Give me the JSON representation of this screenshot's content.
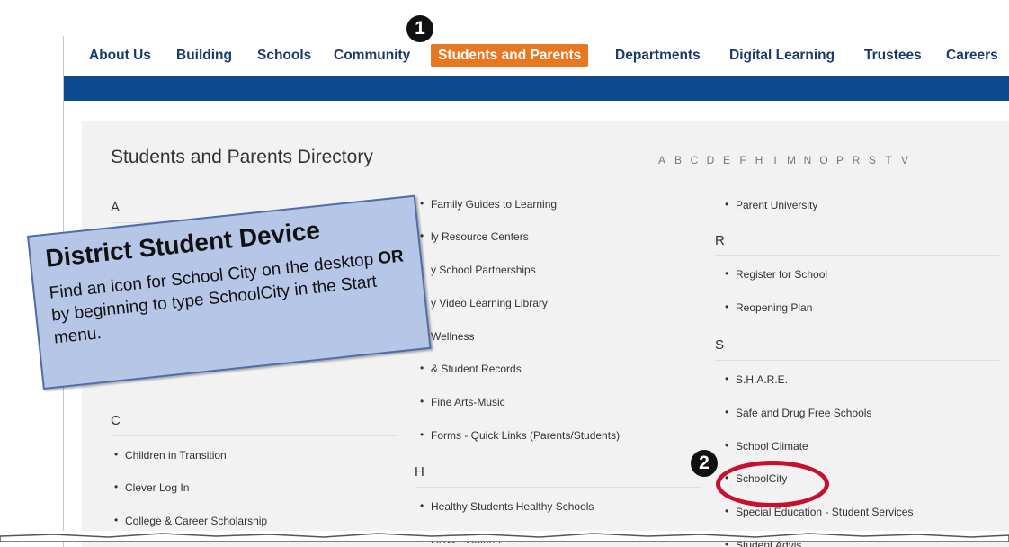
{
  "nav": {
    "items": [
      {
        "label": "About Us"
      },
      {
        "label": "Building"
      },
      {
        "label": "Schools"
      },
      {
        "label": "Community"
      },
      {
        "label": "Students and Parents",
        "active": true
      },
      {
        "label": "Departments"
      },
      {
        "label": "Digital Learning"
      },
      {
        "label": "Trustees"
      },
      {
        "label": "Careers"
      }
    ]
  },
  "directory": {
    "title": "Students and Parents Directory",
    "alphabet": [
      "A",
      "B",
      "C",
      "D",
      "E",
      "F",
      "H",
      "I",
      "M",
      "N",
      "O",
      "P",
      "R",
      "S",
      "T",
      "V"
    ],
    "col1": {
      "letter_a": "A",
      "letter_c": "C",
      "items_c": [
        "Children in Transition",
        "Clever Log In",
        "College & Career Scholarship"
      ]
    },
    "col2": {
      "items_top": [
        "Family Guides to Learning",
        "ly Resource Centers",
        "y School Partnerships",
        "y Video Learning Library",
        "Wellness",
        "& Student Records",
        "Fine Arts-Music",
        "Forms - Quick Links (Parents/Students)"
      ],
      "letter_h": "H",
      "items_h": [
        "Healthy Students Healthy Schools",
        "HRW - Golden"
      ]
    },
    "col3": {
      "items_p": [
        "Parent University"
      ],
      "letter_r": "R",
      "items_r": [
        "Register for School",
        "Reopening Plan"
      ],
      "letter_s": "S",
      "items_s": [
        "S.H.A.R.E.",
        "Safe and Drug Free Schools",
        "School Climate",
        "SchoolCity",
        "Special Education - Student Services",
        "Student Advis"
      ]
    }
  },
  "callout": {
    "title": "District Student Device",
    "body_1": "Find an icon for School City on the desktop ",
    "body_or": "OR",
    "body_2": " by beginning to type SchoolCity in the Start menu."
  },
  "markers": {
    "one": "1",
    "two": "2"
  },
  "colors": {
    "nav_text": "#1a3a6b",
    "active_tab": "#e87722",
    "blue_bar": "#0d4a8f",
    "callout_bg": "#b6c6e6",
    "highlight": "#c8102e"
  }
}
